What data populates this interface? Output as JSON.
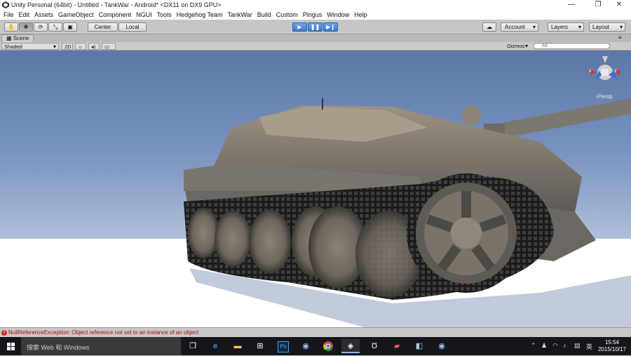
{
  "window": {
    "title": "Unity Personal (64bit) - Untitled - TankWar - Android* <DX11 on DX9 GPU>",
    "minimize_glyph": "—",
    "maximize_glyph": "❐",
    "close_glyph": "✕"
  },
  "menu": [
    "File",
    "Edit",
    "Assets",
    "GameObject",
    "Component",
    "NGUI",
    "Tools",
    "Hedgehog Team",
    "TankWar",
    "Build",
    "Custom",
    "Pingus",
    "Window",
    "Help"
  ],
  "toolbar": {
    "tools": [
      "hand-icon",
      "move-icon",
      "rotate-icon",
      "scale-icon",
      "rect-icon"
    ],
    "pivot_label": "Center",
    "space_label": "Local",
    "account_label": "Account",
    "layers_label": "Layers",
    "layout_label": "Layout",
    "selected_tool_index": 1
  },
  "scene": {
    "tab_label": "Scene",
    "shading_mode": "Shaded",
    "mode_2d": "2D",
    "gizmos_label": "Gizmos",
    "search_placeholder": "All",
    "persp_label": "Persp",
    "axis_x": "x",
    "axis_z": "z"
  },
  "console": {
    "error_message": "NullReferenceException: Object reference not set to an instance of an object"
  },
  "taskbar": {
    "search_placeholder": "搜索 Web 和 Windows",
    "ime_label": "英",
    "time": "15:54",
    "date": "2015/10/17",
    "apps": [
      "task-view-icon",
      "edge-icon",
      "explorer-icon",
      "store-icon",
      "photoshop-icon",
      "app-icon",
      "chrome-icon",
      "unity-icon",
      "unreal-icon",
      "app2-icon",
      "app3-icon",
      "app4-icon"
    ],
    "photoshop_label": "Ps"
  }
}
